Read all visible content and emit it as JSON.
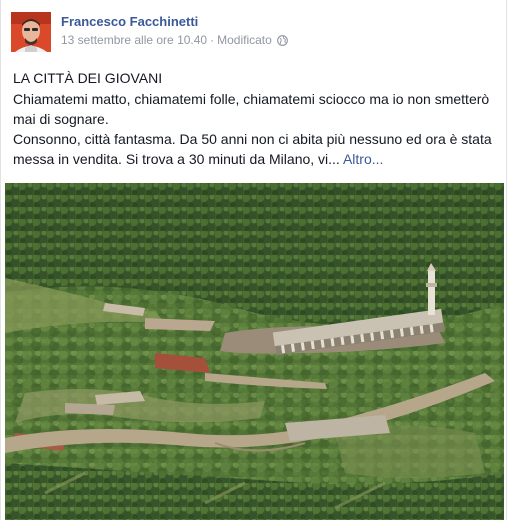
{
  "post": {
    "author": "Francesco Facchinetti",
    "timestamp": "13 settembre alle ore 10.40",
    "separator": "·",
    "edited_label": "Modificato",
    "privacy_icon": "globe-icon",
    "headline": "LA CITTÀ DEI GIOVANI",
    "paragraph_1": "Chiamatemi matto, chiamatemi folle, chiamatemi sciocco ma io non smetterò mai di sognare.",
    "paragraph_2": "Consonno, città fantasma. Da 50 anni non ci abita più nessuno ed ora è stata messa in vendita. Si trova a 30 minuti da Milano, vi...",
    "more_link": "Altro...",
    "photo_description": "aerial-photo"
  },
  "colors": {
    "link": "#3b5998",
    "text": "#141823",
    "meta": "#9197a3",
    "avatar_bg": "#c43a1e"
  }
}
